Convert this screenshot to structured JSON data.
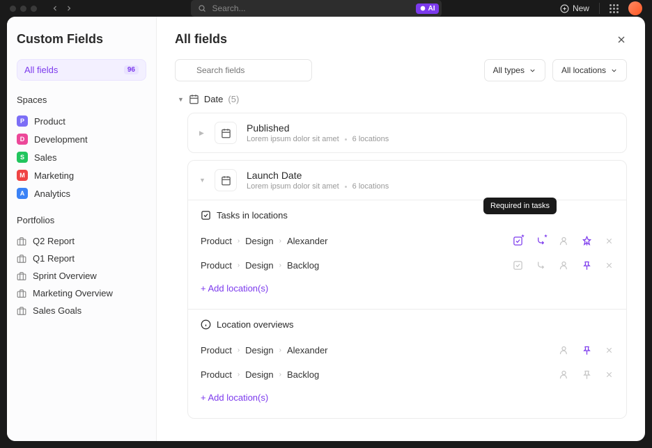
{
  "topbar": {
    "search_placeholder": "Search...",
    "ai_label": "AI",
    "new_button": "New"
  },
  "sidebar": {
    "title": "Custom Fields",
    "all_fields_label": "All fields",
    "all_fields_count": "96",
    "spaces_header": "Spaces",
    "spaces": [
      {
        "letter": "P",
        "color": "#7c6ef6",
        "label": "Product"
      },
      {
        "letter": "D",
        "color": "#ec4899",
        "label": "Development"
      },
      {
        "letter": "S",
        "color": "#22c55e",
        "label": "Sales"
      },
      {
        "letter": "M",
        "color": "#ef4444",
        "label": "Marketing"
      },
      {
        "letter": "A",
        "color": "#3b82f6",
        "label": "Analytics"
      }
    ],
    "portfolios_header": "Portfolios",
    "portfolios": [
      {
        "label": "Q2 Report"
      },
      {
        "label": "Q1 Report"
      },
      {
        "label": "Sprint Overview"
      },
      {
        "label": "Marketing Overview"
      },
      {
        "label": "Sales Goals"
      }
    ]
  },
  "main": {
    "title": "All fields",
    "search_placeholder": "Search fields",
    "filter_types": "All types",
    "filter_locations": "All locations",
    "group_name": "Date",
    "group_count": "(5)",
    "fields": [
      {
        "name": "Published",
        "desc": "Lorem ipsum dolor sit amet",
        "loc": "6 locations"
      },
      {
        "name": "Launch Date",
        "desc": "Lorem ipsum dolor sit amet",
        "loc": "6 locations"
      }
    ],
    "tasks_header": "Tasks in locations",
    "overviews_header": "Location overviews",
    "tooltip_text": "Required in tasks",
    "add_locations": "+ Add location(s)",
    "task_rows": [
      {
        "p0": "Product",
        "p1": "Design",
        "p2": "Alexander"
      },
      {
        "p0": "Product",
        "p1": "Design",
        "p2": "Backlog"
      }
    ],
    "overview_rows": [
      {
        "p0": "Product",
        "p1": "Design",
        "p2": "Alexander"
      },
      {
        "p0": "Product",
        "p1": "Design",
        "p2": "Backlog"
      }
    ]
  }
}
